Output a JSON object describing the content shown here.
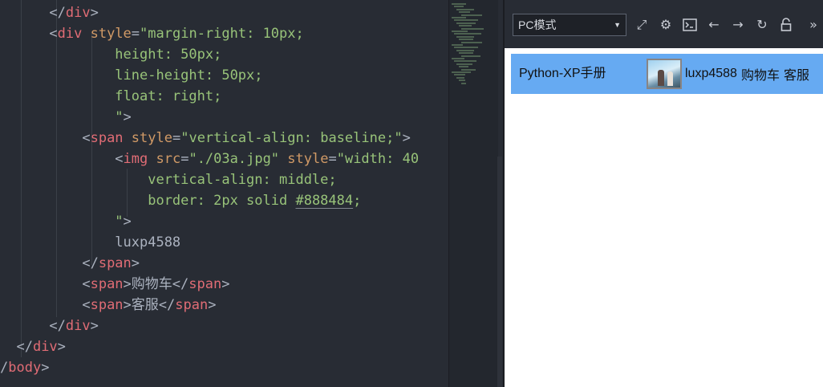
{
  "editor": {
    "lines": [
      [
        [
          "t-punc",
          "      </"
        ],
        [
          "t-tag",
          "div"
        ],
        [
          "t-punc",
          ">"
        ]
      ],
      [
        [
          "t-punc",
          "      <"
        ],
        [
          "t-tag",
          "div"
        ],
        [
          "t-attr",
          " style"
        ],
        [
          "t-punc",
          "="
        ],
        [
          "t-str",
          "\"margin-right: 10px;"
        ]
      ],
      [
        [
          "t-str",
          "              height: 50px;"
        ]
      ],
      [
        [
          "t-str",
          "              line-height: 50px;"
        ]
      ],
      [
        [
          "t-str",
          "              float: right;"
        ]
      ],
      [
        [
          "t-str",
          "              \""
        ],
        [
          "t-punc",
          ">"
        ]
      ],
      [
        [
          "t-punc",
          "          <"
        ],
        [
          "t-tag",
          "span"
        ],
        [
          "t-attr",
          " style"
        ],
        [
          "t-punc",
          "="
        ],
        [
          "t-str",
          "\"vertical-align: baseline;\""
        ],
        [
          "t-punc",
          ">"
        ]
      ],
      [
        [
          "t-punc",
          "              <"
        ],
        [
          "t-tag",
          "img"
        ],
        [
          "t-attr",
          " src"
        ],
        [
          "t-punc",
          "="
        ],
        [
          "t-str",
          "\"./03a.jpg\""
        ],
        [
          "t-attr",
          " style"
        ],
        [
          "t-punc",
          "="
        ],
        [
          "t-str",
          "\"width: 40"
        ]
      ],
      [
        [
          "t-str",
          "                  vertical-align: middle;"
        ]
      ],
      [
        [
          "t-str",
          "                  border: 2px solid "
        ],
        [
          "t-hex",
          "#888484"
        ],
        [
          "t-str",
          ";"
        ]
      ],
      [
        [
          "t-str",
          "              \""
        ],
        [
          "t-punc",
          ">"
        ]
      ],
      [
        [
          "t-text",
          "              luxp4588"
        ]
      ],
      [
        [
          "t-punc",
          "          </"
        ],
        [
          "t-tag",
          "span"
        ],
        [
          "t-punc",
          ">"
        ]
      ],
      [
        [
          "t-punc",
          "          <"
        ],
        [
          "t-tag",
          "span"
        ],
        [
          "t-punc",
          ">"
        ],
        [
          "t-text",
          "购物车"
        ],
        [
          "t-punc",
          "</"
        ],
        [
          "t-tag",
          "span"
        ],
        [
          "t-punc",
          ">"
        ]
      ],
      [
        [
          "t-punc",
          "          <"
        ],
        [
          "t-tag",
          "span"
        ],
        [
          "t-punc",
          ">"
        ],
        [
          "t-text",
          "客服"
        ],
        [
          "t-punc",
          "</"
        ],
        [
          "t-tag",
          "span"
        ],
        [
          "t-punc",
          ">"
        ]
      ],
      [
        [
          "t-punc",
          "      </"
        ],
        [
          "t-tag",
          "div"
        ],
        [
          "t-punc",
          ">"
        ]
      ],
      [
        [
          "t-punc",
          "  </"
        ],
        [
          "t-tag",
          "div"
        ],
        [
          "t-punc",
          ">"
        ]
      ],
      [
        [
          "t-punc",
          "/"
        ],
        [
          "t-tag",
          "body"
        ],
        [
          "t-punc",
          ">"
        ]
      ]
    ]
  },
  "toolbar": {
    "mode_value": "PC模式",
    "icons": [
      "expand-icon",
      "gear-icon",
      "terminal-icon",
      "back-arrow-icon",
      "forward-arrow-icon",
      "refresh-icon",
      "unlock-icon",
      "more-icon"
    ]
  },
  "preview": {
    "title": "Python-XP手册",
    "username": "luxp4588",
    "cart": "购物车",
    "service": "客服",
    "nav_color": "#66aaf2",
    "avatar_border": "#888484"
  }
}
